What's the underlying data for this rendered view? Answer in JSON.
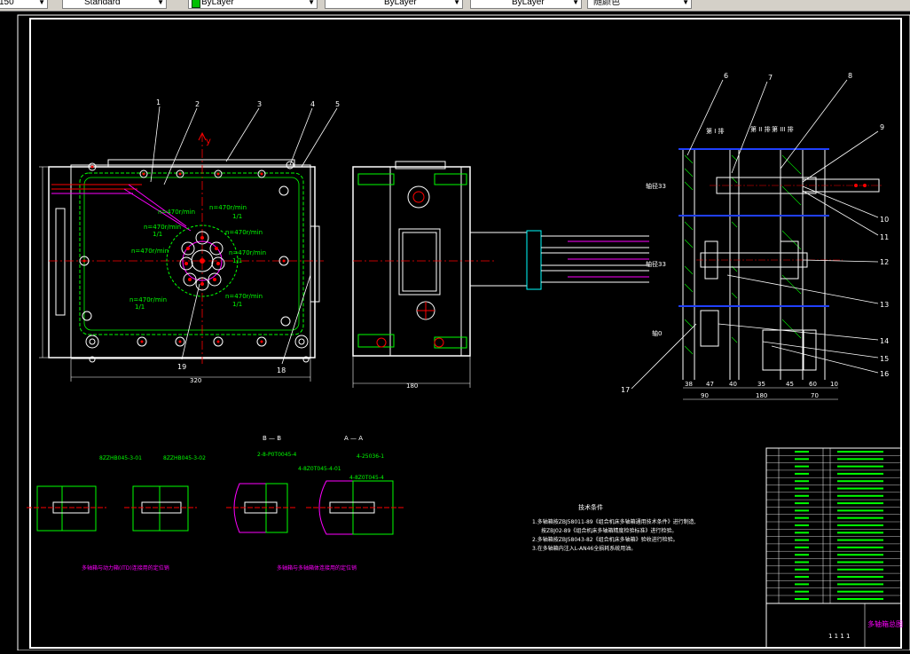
{
  "toolbar": {
    "scale_combo": "150",
    "style_combo": "Standard",
    "layer_combo": "ByLayer",
    "linetype_combo": "ByLayer",
    "lineweight_combo": "ByLayer",
    "color_combo": "随颜色",
    "colors": {
      "bg": "#d4d0c8",
      "swatch": "#00c000"
    }
  },
  "drawing": {
    "balloons_top": [
      "1",
      "2",
      "3",
      "4",
      "5"
    ],
    "balloons_right": [
      "6",
      "7",
      "8",
      "9",
      "10",
      "11",
      "12",
      "13",
      "14",
      "15",
      "16",
      "17"
    ],
    "balloon_18": "18",
    "balloon_19": "19",
    "axis_y": "y",
    "speed_labels": [
      "n=470r/min",
      "n=470r/min",
      "n=470r/min",
      "n=470r/min",
      "n=470r/min",
      "n=470r/min"
    ],
    "ratio": "1/1",
    "dims": {
      "width_320": "320",
      "side_180": "180",
      "right_180": "180"
    },
    "right_dims_top": [
      "38",
      "47",
      "40",
      "35",
      "45",
      "60",
      "10"
    ],
    "right_dims_bottom": [
      "90",
      "180",
      "70"
    ],
    "col_labels": [
      "第 I 排",
      "第 II 排",
      "第 III 排"
    ],
    "left_labels": [
      "轴径33",
      "轴径33",
      "轴0"
    ],
    "section_bb": "B — B",
    "section_aa": "A — A",
    "detail_labels": [
      "8ZZHB045-3-01",
      "8ZZHB045-3-02",
      "2-8-P0T0045-4",
      "4-8Z0T045-4-01",
      "4-8Z0T045-4",
      "4-25036-1"
    ],
    "caption_left": "多轴箱与动力箱(ITD)连接用的定位销",
    "caption_right": "多轴箱与多轴箱体连接用的定位销",
    "notes_title": "技术条件",
    "notes": [
      "1.多轴箱按ZBJ58011-89《组合机床多轴箱通用技术条件》进行制造,",
      "按ZBJ02-89《组合机床多轴箱精度检验标准》进行检验。",
      "2.多轴箱按ZBJ58043-82《组合机床多轴箱》验收进行检验。",
      "3.在多轴箱内注入L-AN46全损耗系统用油。"
    ],
    "title_block": {
      "name": "多轴箱总图",
      "code": "1 1 1 1"
    }
  },
  "colors": {
    "frame": "#ffffff",
    "green": "#00ff00",
    "red": "#ff0000",
    "magenta": "#ff00ff",
    "cyan": "#00ffff",
    "yellow": "#ffff00",
    "blue": "#2040ff"
  }
}
